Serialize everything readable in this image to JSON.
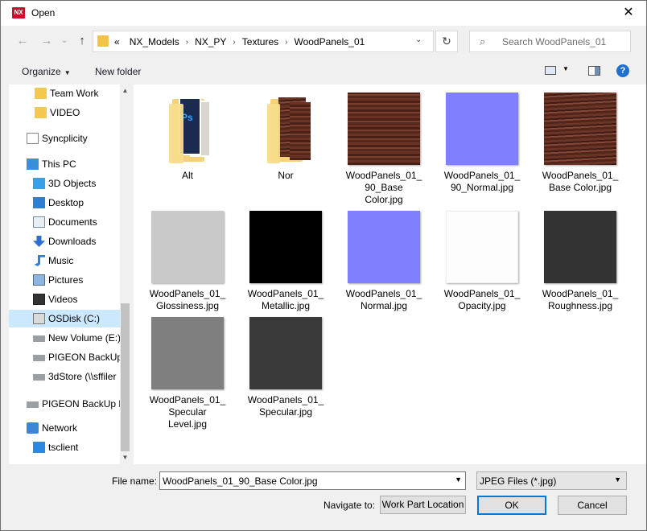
{
  "titlebar": {
    "app_icon": "NX",
    "title": "Open",
    "close_glyph": "✕"
  },
  "nav": {
    "back_glyph": "←",
    "forward_glyph": "→",
    "up_glyph": "↑",
    "breadcrumb_prefix": "«",
    "breadcrumbs": [
      "NX_Models",
      "NX_PY",
      "Textures",
      "WoodPanels_01"
    ],
    "separator": "›",
    "dropdown_glyph": "⌄",
    "refresh_glyph": "↻",
    "search_placeholder": "Search WoodPanels_01"
  },
  "toolbar": {
    "organize_label": "Organize",
    "new_folder_label": "New folder",
    "help_glyph": "?"
  },
  "sidebar": {
    "items": [
      {
        "label": "Team Work",
        "icon": "folder-icon"
      },
      {
        "label": "VIDEO",
        "icon": "folder-icon"
      },
      {
        "label": "Syncplicity",
        "icon": "document-icon"
      },
      {
        "label": "This PC",
        "icon": "computer-icon"
      },
      {
        "label": "3D Objects",
        "icon": "cube-icon"
      },
      {
        "label": "Desktop",
        "icon": "desktop-icon"
      },
      {
        "label": "Documents",
        "icon": "documents-icon"
      },
      {
        "label": "Downloads",
        "icon": "download-icon"
      },
      {
        "label": "Music",
        "icon": "music-icon"
      },
      {
        "label": "Pictures",
        "icon": "pictures-icon"
      },
      {
        "label": "Videos",
        "icon": "video-icon"
      },
      {
        "label": "OSDisk (C:)",
        "icon": "disk-icon"
      },
      {
        "label": "New Volume (E:)",
        "icon": "drive-icon"
      },
      {
        "label": "PIGEON BackUp",
        "icon": "drive-icon"
      },
      {
        "label": "3dStore (\\\\sffiler",
        "icon": "network-drive-icon"
      },
      {
        "label": "PIGEON BackUp D",
        "icon": "drive-icon"
      },
      {
        "label": "Network",
        "icon": "network-icon"
      },
      {
        "label": "tsclient",
        "icon": "monitor-icon"
      }
    ],
    "selected": "OSDisk (C:)"
  },
  "files": [
    {
      "name": "Alt",
      "kind": "folder",
      "preview": "ps-folder"
    },
    {
      "name": "Nor",
      "kind": "folder",
      "preview": "wood-folder"
    },
    {
      "name": "WoodPanels_01_90_Base Color.jpg",
      "display": "WoodPanels_01_\n90_Base\nColor.jpg",
      "kind": "image",
      "color": "#5a2a1e"
    },
    {
      "name": "WoodPanels_01_90_Normal.jpg",
      "display": "WoodPanels_01_\n90_Normal.jpg",
      "kind": "image",
      "color": "#8080ff"
    },
    {
      "name": "WoodPanels_01_Base Color.jpg",
      "display": "WoodPanels_01_\nBase Color.jpg",
      "kind": "image",
      "color": "#5d2b1f"
    },
    {
      "name": "WoodPanels_01_Glossiness.jpg",
      "display": "WoodPanels_01_\nGlossiness.jpg",
      "kind": "image",
      "color": "#c9c9c9"
    },
    {
      "name": "WoodPanels_01_Metallic.jpg",
      "display": "WoodPanels_01_\nMetallic.jpg",
      "kind": "image",
      "color": "#000000"
    },
    {
      "name": "WoodPanels_01_Normal.jpg",
      "display": "WoodPanels_01_\nNormal.jpg",
      "kind": "image",
      "color": "#8080ff"
    },
    {
      "name": "WoodPanels_01_Opacity.jpg",
      "display": "WoodPanels_01_\nOpacity.jpg",
      "kind": "image",
      "color": "#fdfdfd"
    },
    {
      "name": "WoodPanels_01_Roughness.jpg",
      "display": "WoodPanels_01_\nRoughness.jpg",
      "kind": "image",
      "color": "#333333"
    },
    {
      "name": "WoodPanels_01_Specular Level.jpg",
      "display": "WoodPanels_01_\nSpecular\nLevel.jpg",
      "kind": "image",
      "color": "#7f7f7f"
    },
    {
      "name": "WoodPanels_01_Specular.jpg",
      "display": "WoodPanels_01_\nSpecular.jpg",
      "kind": "image",
      "color": "#3a3a3a"
    }
  ],
  "bottom": {
    "filename_label": "File name:",
    "filename_value": "WoodPanels_01_90_Base Color.jpg",
    "filetype_value": "JPEG Files (*.jpg)",
    "navigate_label": "Navigate to:",
    "navigate_button": "Work Part Location",
    "ok_label": "OK",
    "cancel_label": "Cancel",
    "dropdown_glyph": "⌄"
  },
  "colors": {
    "accent": "#0078d7",
    "selection": "#cce8ff"
  }
}
